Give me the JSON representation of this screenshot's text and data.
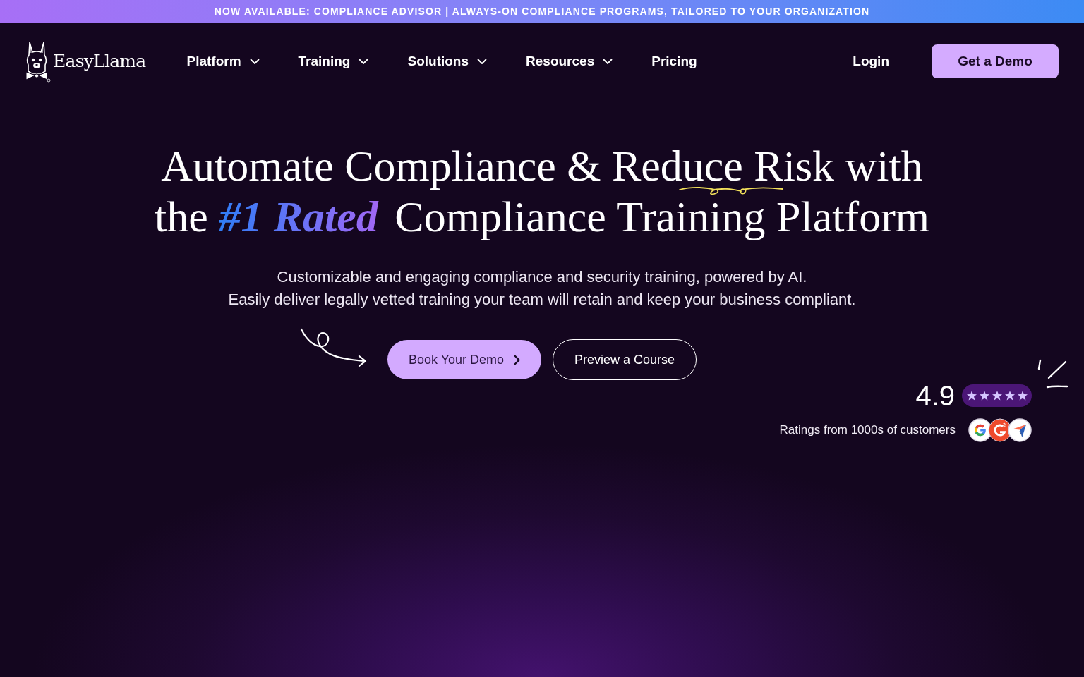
{
  "announcement": {
    "text": "NOW AVAILABLE: COMPLIANCE ADVISOR | ALWAYS-ON COMPLIANCE PROGRAMS, TAILORED TO YOUR ORGANIZATION"
  },
  "nav": {
    "logo": "EasyLlama",
    "items": [
      {
        "label": "Platform",
        "kind": "dropdown"
      },
      {
        "label": "Training",
        "kind": "dropdown"
      },
      {
        "label": "Solutions",
        "kind": "dropdown"
      },
      {
        "label": "Resources",
        "kind": "dropdown"
      },
      {
        "label": "Pricing",
        "kind": "link"
      }
    ],
    "login": "Login",
    "cta": "Get a Demo"
  },
  "hero": {
    "title_lines": [
      "Automate Compliance & Reduce Risk with",
      "the *#1 Rated* Compliance Training Platform"
    ],
    "subtitle_lines": [
      "Customizable and engaging compliance and security training, powered by AI.",
      "Easily deliver legally vetted training your team will retain and keep your business compliant."
    ],
    "buttons": [
      {
        "label": "Book Your Demo",
        "kind": "primary"
      },
      {
        "label": "Preview a Course",
        "kind": "secondary"
      }
    ]
  },
  "rating": {
    "score": "4.9",
    "stars": 5,
    "caption": "Ratings from 1000s of customers"
  }
}
